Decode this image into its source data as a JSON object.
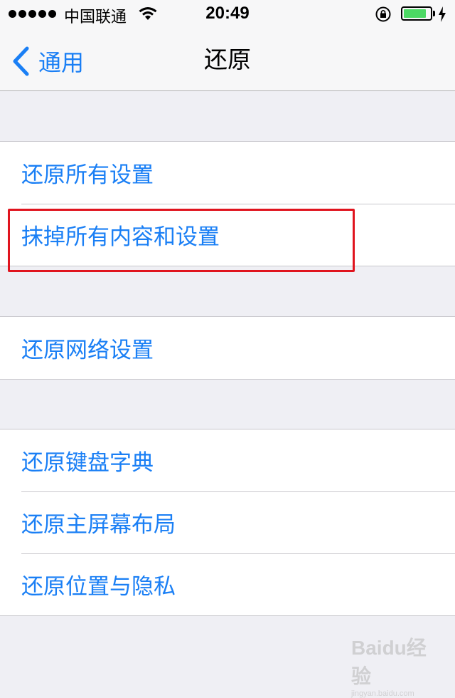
{
  "status_bar": {
    "carrier": "中国联通",
    "time": "20:49",
    "battery_level": 0.85
  },
  "nav": {
    "back_label": "通用",
    "title": "还原"
  },
  "groups": [
    {
      "items": [
        "还原所有设置",
        "抹掉所有内容和设置"
      ]
    },
    {
      "items": [
        "还原网络设置"
      ]
    },
    {
      "items": [
        "还原键盘字典",
        "还原主屏幕布局",
        "还原位置与隐私"
      ]
    }
  ],
  "watermark": {
    "logo": "Baidu经验",
    "url": "jingyan.baidu.com"
  },
  "colors": {
    "accent": "#1a7ff5",
    "highlight": "#e0141e",
    "battery": "#4cd964"
  }
}
